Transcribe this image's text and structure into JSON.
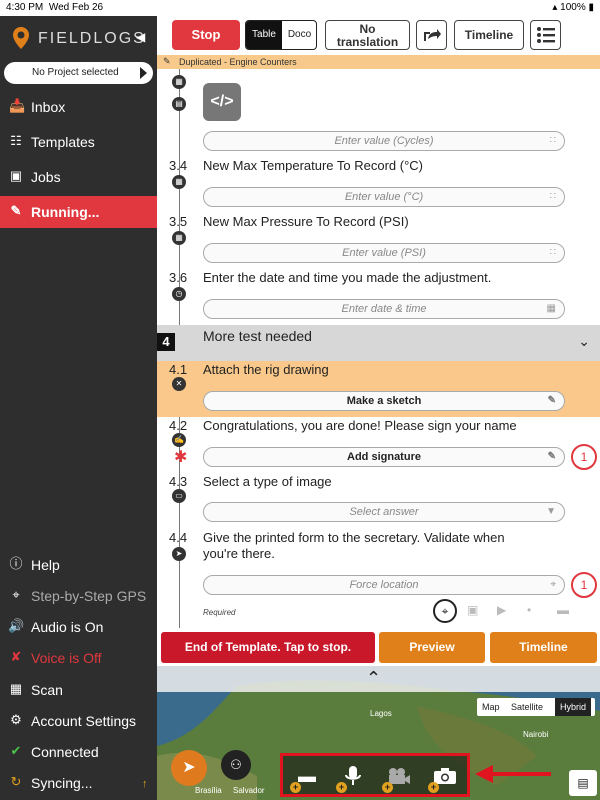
{
  "status": {
    "time": "4:30 PM",
    "date": "Wed Feb 26",
    "battery": "100%"
  },
  "sidebar": {
    "logo_text": "FIELDLOGS",
    "project": "No Project selected",
    "items": [
      {
        "label": "Inbox",
        "icon": "inbox-icon"
      },
      {
        "label": "Templates",
        "icon": "templates-icon"
      },
      {
        "label": "Jobs",
        "icon": "briefcase-icon"
      },
      {
        "label": "Running...",
        "icon": "pencil-icon"
      }
    ],
    "bottom": [
      {
        "label": "Help",
        "icon": "help-icon"
      },
      {
        "label": "Step-by-Step GPS",
        "icon": "gps-pin-icon"
      },
      {
        "label": "Audio is On",
        "icon": "speaker-icon"
      },
      {
        "label": "Voice is Off",
        "icon": "mic-off-icon"
      },
      {
        "label": "Scan",
        "icon": "qr-icon"
      },
      {
        "label": "Account Settings",
        "icon": "gear-icon"
      },
      {
        "label": "Connected",
        "icon": "check-icon"
      },
      {
        "label": "Syncing...",
        "icon": "sync-icon"
      }
    ]
  },
  "toolbar": {
    "stop": "Stop",
    "table": "Table",
    "doco": "Doco",
    "no_translation_1": "No",
    "no_translation_2": "translation",
    "timeline": "Timeline"
  },
  "banner": "Duplicated - Engine Counters",
  "questions": {
    "q33_placeholder": "Enter value (Cycles)",
    "q34": {
      "num": "3.4",
      "text": "New Max Temperature To Record (°C)",
      "placeholder": "Enter value (°C)"
    },
    "q35": {
      "num": "3.5",
      "text": "New Max Pressure To Record (PSI)",
      "placeholder": "Enter value (PSI)"
    },
    "q36": {
      "num": "3.6",
      "text": "Enter the date and time you made the adjustment.",
      "placeholder": "Enter date & time"
    },
    "section4": {
      "num": "4",
      "text": "More test needed"
    },
    "q41": {
      "num": "4.1",
      "text": "Attach the rig drawing",
      "button": "Make a sketch"
    },
    "q42": {
      "num": "4.2",
      "text": "Congratulations, you are done! Please sign your name",
      "button": "Add signature",
      "badge": "1"
    },
    "q43": {
      "num": "4.3",
      "text": "Select a type of image",
      "placeholder": "Select answer"
    },
    "q44": {
      "num": "4.4",
      "text_1": "Give the printed form to the secretary. Validate when",
      "text_2": "you're there.",
      "placeholder": "Force location",
      "badge": "1"
    },
    "required": "Required"
  },
  "actions": {
    "end": "End of Template. Tap to stop.",
    "preview": "Preview",
    "timeline": "Timeline"
  },
  "map": {
    "types": [
      "Map",
      "Satellite",
      "Hybrid"
    ],
    "selected_type": "Hybrid",
    "labels": [
      "Lagos",
      "Nairobi",
      "Brasília",
      "Salvador"
    ]
  },
  "colors": {
    "accent_red": "#e0383e",
    "accent_orange": "#e0801a",
    "highlight": "#f9c88a"
  }
}
